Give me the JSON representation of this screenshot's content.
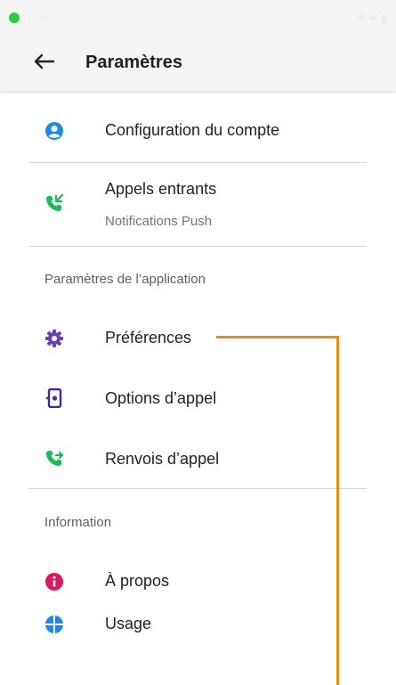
{
  "header": {
    "title": "Paramètres"
  },
  "account": {
    "label": "Configuration du compte"
  },
  "incoming": {
    "label": "Appels entrants",
    "sublabel": "Notifications Push"
  },
  "section_app": {
    "title": "Paramètres de l’application",
    "items": [
      {
        "label": "Préférences",
        "icon": "gear-icon"
      },
      {
        "label": "Options d’appel",
        "icon": "phone-settings-icon"
      },
      {
        "label": "Renvois d’appel",
        "icon": "call-forward-icon"
      }
    ]
  },
  "section_info": {
    "title": "Information",
    "items": [
      {
        "label": "À propos",
        "icon": "info-icon"
      },
      {
        "label": "Usage",
        "icon": "pie-chart-icon"
      }
    ]
  },
  "colors": {
    "blue": "#1e88e5",
    "green": "#1db954",
    "purple": "#6a3fb0",
    "pink": "#d81b60",
    "annotation": "#f08a17"
  }
}
